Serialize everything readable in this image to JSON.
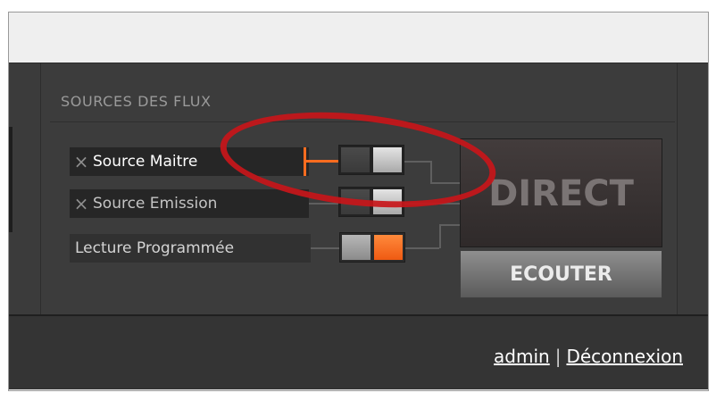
{
  "section": {
    "title": "SOURCES DES FLUX"
  },
  "sources": [
    {
      "label": "Source Maitre",
      "remove_icon": "×"
    },
    {
      "label": "Source Emission",
      "remove_icon": "×"
    },
    {
      "label": "Lecture Programmée"
    }
  ],
  "live": {
    "direct_label": "DIRECT",
    "listen_label": "ECOUTER"
  },
  "user": {
    "name": "admin",
    "separator": "|",
    "logout": "Déconnexion"
  },
  "colors": {
    "accent": "#ff6c1f",
    "annotation": "#c8161a"
  }
}
